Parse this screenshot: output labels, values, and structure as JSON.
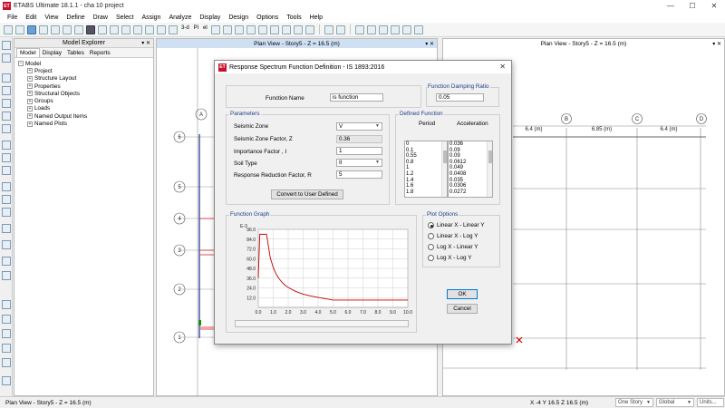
{
  "window": {
    "title": "ETABS Ultimate 18.1.1 - cha 10 project",
    "logo_text": "ET",
    "minimize": "—",
    "maximize": "☐",
    "close": "✕"
  },
  "menu": [
    "File",
    "Edit",
    "View",
    "Define",
    "Draw",
    "Select",
    "Assign",
    "Analyze",
    "Display",
    "Design",
    "Options",
    "Tools",
    "Help"
  ],
  "toolbar": {
    "view3d": "3-d",
    "plan": "Pl",
    "elev": "el"
  },
  "explorer": {
    "title": "Model Explorer",
    "ctrl": "▾ ✕",
    "tabs": [
      "Model",
      "Display",
      "Tables",
      "Reports"
    ],
    "root": "Model",
    "items": [
      "Project",
      "Structure Layout",
      "Properties",
      "Structural Objects",
      "Groups",
      "Loads",
      "Named Output Items",
      "Named Plots"
    ]
  },
  "plan1": {
    "title": "Plan View - Story5 - Z = 16.5 (m)",
    "ctrl": "▾ ✕",
    "grid_labels": [
      "A",
      "6",
      "5",
      "4",
      "3",
      "2",
      "1"
    ]
  },
  "plan2": {
    "title": "Plan View - Story5 - Z = 16.5 (m)",
    "ctrl": "▾ ✕",
    "grid_labels": [
      "B",
      "C",
      "D"
    ],
    "dims": [
      "6.4 (m)",
      "6.85 (m)",
      "6.4 (m)"
    ]
  },
  "dialog": {
    "title": "Response Spectrum Function Definition - IS 1893:2016",
    "logo_text": "ET",
    "close": "✕",
    "function_name_label": "Function Name",
    "function_name": "is function",
    "damping_title": "Function Damping Ratio",
    "damping_value": "0.05",
    "params_title": "Parameters",
    "params": {
      "seismic_zone_label": "Seismic Zone",
      "seismic_zone": "V",
      "zone_factor_label": "Seismic Zone Factor, Z",
      "zone_factor": "0.36",
      "importance_label": "Importance Factor , I",
      "importance": "1",
      "soil_label": "Soil Type",
      "soil": "II",
      "reduction_label": "Response Reduction Factor, R",
      "reduction": "5"
    },
    "convert_button": "Convert to User Defined",
    "defined_title": "Defined Function",
    "period_header": "Period",
    "accel_header": "Acceleration",
    "periods": [
      "0",
      "0.1",
      "0.55",
      "0.8",
      "1",
      "1.2",
      "1.4",
      "1.6",
      "1.8"
    ],
    "accels": [
      "0.036",
      "0.09",
      "0.09",
      "0.0612",
      "0.049",
      "0.0408",
      "0.035",
      "0.0306",
      "0.0272"
    ],
    "graph_title": "Function Graph",
    "plot_options_title": "Plot Options",
    "plot_options": [
      "Linear X - Linear Y",
      "Linear X - Log Y",
      "Log X - Linear Y",
      "Log X - Log Y"
    ],
    "plot_selected": 0,
    "ok": "OK",
    "cancel": "Cancel"
  },
  "chart_data": {
    "type": "line",
    "ylabel": "E-3",
    "y_ticks": [
      "96.0",
      "84.0",
      "72.0",
      "60.0",
      "48.0",
      "36.0",
      "24.0",
      "12.0"
    ],
    "x_ticks": [
      "0.0",
      "1.0",
      "2.0",
      "3.0",
      "4.0",
      "5.0",
      "6.0",
      "7.0",
      "8.0",
      "9.0",
      "10.0"
    ],
    "xlim": [
      0,
      10
    ],
    "ylim": [
      0,
      96
    ],
    "grid": true,
    "series": [
      {
        "color": "#c00000",
        "x": [
          0,
          0.1,
          0.55,
          0.8,
          1.0,
          1.2,
          1.4,
          1.6,
          1.8,
          2.0,
          2.5,
          3.0,
          3.5,
          4.0,
          5.0,
          6.0,
          7.0,
          8.0,
          9.0,
          10.0
        ],
        "y": [
          36,
          90,
          90,
          61.2,
          49,
          40.8,
          35,
          30.6,
          27.2,
          24.5,
          19.6,
          16.3,
          14,
          12.2,
          9,
          9,
          9,
          9,
          9,
          9
        ]
      }
    ]
  },
  "status": {
    "left": "Plan View - Story5 - Z = 16.5 (m)",
    "coords": "X -4  Y 16.5  Z 16.5 (m)",
    "story": "One Story",
    "global": "Global",
    "units": "Units..."
  },
  "colors": {
    "accent": "#0078d7",
    "title_logo": "#c8102e",
    "graph_line": "#c00000",
    "group_title": "#1e3c8c"
  }
}
